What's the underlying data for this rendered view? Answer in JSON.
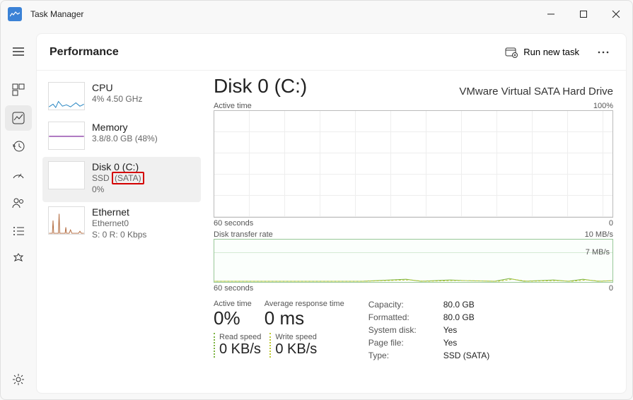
{
  "app": {
    "title": "Task Manager"
  },
  "page": {
    "title": "Performance",
    "run_task": "Run new task"
  },
  "sidebar": {
    "items": [
      {
        "title": "CPU",
        "sub1": "4% 4.50 GHz",
        "sub2": ""
      },
      {
        "title": "Memory",
        "sub1": "3.8/8.0 GB (48%)",
        "sub2": ""
      },
      {
        "title": "Disk 0 (C:)",
        "sub1_pre": "SSD ",
        "sub1_mark": "(SATA)",
        "sub2": "0%"
      },
      {
        "title": "Ethernet",
        "sub1": "Ethernet0",
        "sub2": "S: 0 R: 0 Kbps"
      }
    ]
  },
  "main": {
    "title": "Disk 0 (C:)",
    "model": "VMware Virtual SATA Hard Drive",
    "chart1": {
      "label": "Active time",
      "max": "100%",
      "x_left": "60 seconds",
      "x_right": "0"
    },
    "chart2": {
      "label": "Disk transfer rate",
      "max": "10 MB/s",
      "mid": "7 MB/s",
      "x_left": "60 seconds",
      "x_right": "0"
    },
    "stats": {
      "active_time_label": "Active time",
      "active_time": "0%",
      "avg_resp_label": "Average response time",
      "avg_resp": "0 ms",
      "read_label": "Read speed",
      "read": "0 KB/s",
      "write_label": "Write speed",
      "write": "0 KB/s"
    },
    "info": {
      "capacity_k": "Capacity:",
      "capacity_v": "80.0 GB",
      "formatted_k": "Formatted:",
      "formatted_v": "80.0 GB",
      "system_k": "System disk:",
      "system_v": "Yes",
      "pagefile_k": "Page file:",
      "pagefile_v": "Yes",
      "type_k": "Type:",
      "type_v": "SSD (SATA)"
    }
  },
  "chart_data": [
    {
      "type": "line",
      "title": "Active time",
      "ylabel": "%",
      "ylim": [
        0,
        100
      ],
      "x_seconds": [
        60,
        0
      ],
      "values": [
        0,
        0,
        0,
        0,
        0,
        0,
        0,
        0,
        0,
        0,
        0,
        0
      ]
    },
    {
      "type": "line",
      "title": "Disk transfer rate",
      "ylabel": "MB/s",
      "ylim": [
        0,
        10
      ],
      "series": [
        {
          "name": "Read",
          "values": [
            0,
            0,
            0,
            0,
            0,
            0,
            0,
            0,
            0,
            0.3,
            0,
            0.2,
            0.1,
            0,
            0,
            0.4,
            0,
            0.2,
            0
          ]
        },
        {
          "name": "Write",
          "values": [
            0,
            0,
            0,
            0,
            0,
            0,
            0,
            0,
            0,
            0.2,
            0,
            0.1,
            0.1,
            0,
            0,
            0.3,
            0,
            0.1,
            0
          ]
        }
      ]
    }
  ]
}
